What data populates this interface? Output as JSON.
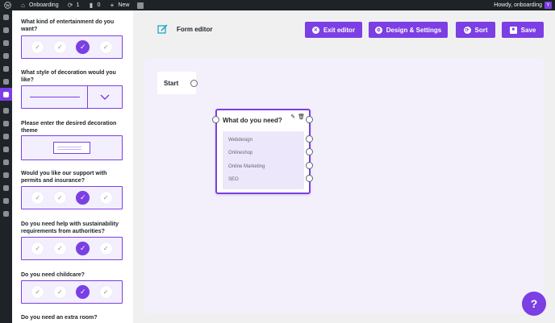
{
  "adminbar": {
    "site_name": "Onboarding",
    "updates": "1",
    "comments": "0",
    "new_label": "New",
    "howdy": "Howdy, onboarding"
  },
  "sidebar_icons": [
    "dashboard-icon",
    "pin-icon",
    "media-icon",
    "pages-icon",
    "comments-icon",
    "plugin-active-icon",
    "appearance-icon",
    "folder-icon",
    "tools-icon",
    "plugins-icon",
    "users-icon",
    "wrench-icon",
    "settings-icon",
    "y-icon",
    "play-icon"
  ],
  "preview": {
    "questions": [
      {
        "title": "What kind of entertainment do you want?",
        "type": "checks",
        "selected": 2
      },
      {
        "title": "What style of decoration would you like?",
        "type": "dropdown"
      },
      {
        "title": "Please enter the desired decoration theme",
        "type": "textarea"
      },
      {
        "title": "Would you like our support with permits and insurance?",
        "type": "checks",
        "selected": 2
      },
      {
        "title": "Do you need help with sustainability requirements from authorities?",
        "type": "checks",
        "selected": 2
      },
      {
        "title": "Do you need childcare?",
        "type": "checks",
        "selected": 2
      },
      {
        "title": "Do you need an extra room?",
        "type": "none"
      }
    ]
  },
  "header": {
    "title": "Form editor",
    "exit_label": "Exit editor",
    "design_label": "Design & Settings",
    "sort_label": "Sort",
    "save_label": "Save"
  },
  "canvas": {
    "start_label": "Start",
    "question_title": "What do you need?",
    "options": [
      "Webdesign",
      "Onlineshop",
      "Online Marketing",
      "SEO"
    ]
  },
  "help_label": "?",
  "colors": {
    "accent": "#7b3fe4",
    "adminbar": "#1d2327",
    "canvas": "#f3f0fc"
  }
}
